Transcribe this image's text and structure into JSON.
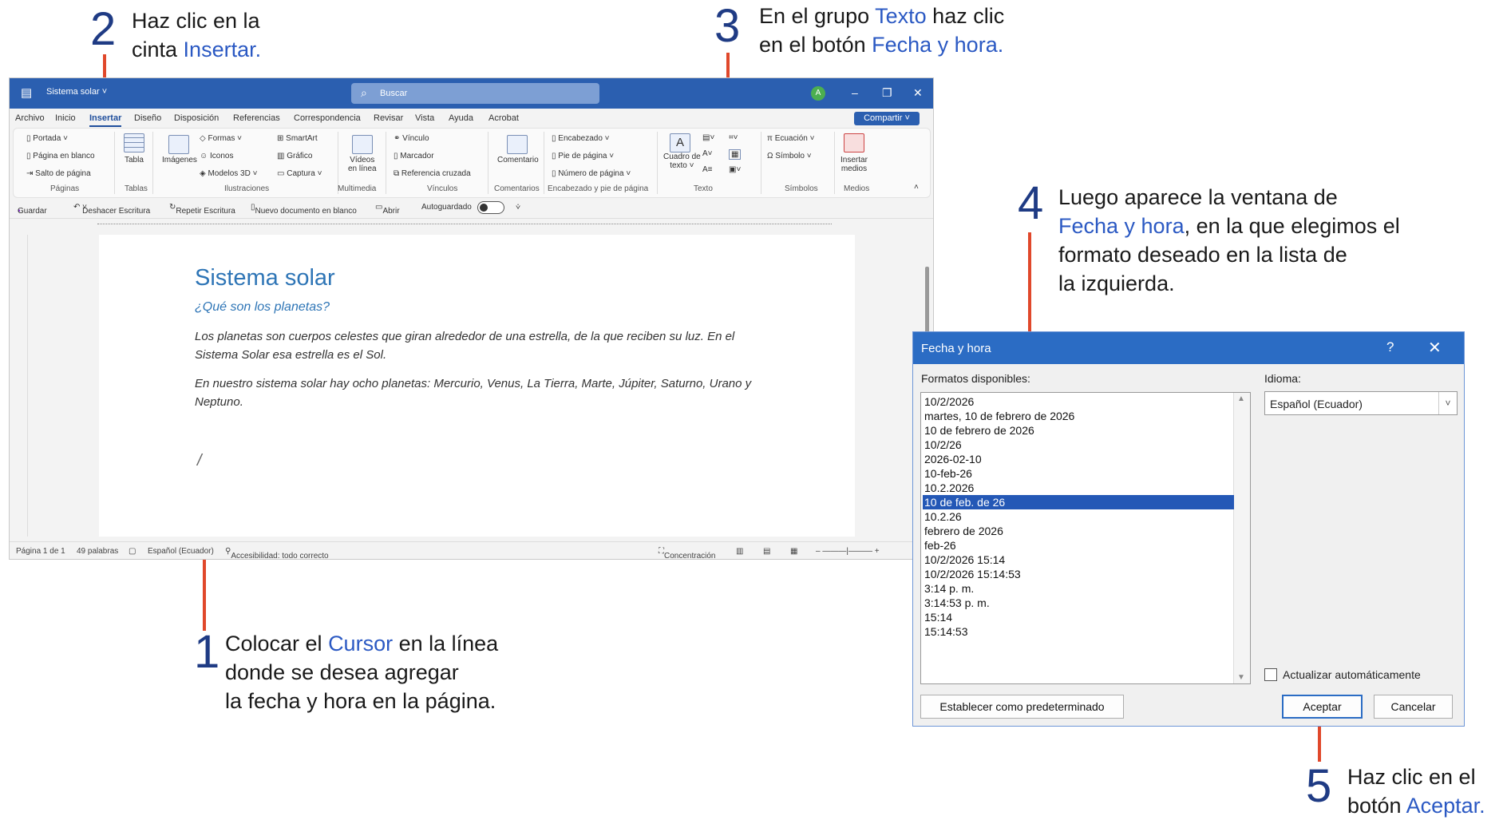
{
  "steps": {
    "s1": {
      "num": "1",
      "l1a": "Colocar el ",
      "l1b": "Cursor",
      "l1c": " en la línea",
      "l2": "donde se desea agregar",
      "l3": "la fecha y hora en la página."
    },
    "s2": {
      "num": "2",
      "l1": "Haz clic en la",
      "l2a": "cinta ",
      "l2b": "Insertar."
    },
    "s3": {
      "num": "3",
      "l1a": "En el grupo ",
      "l1b": "Texto",
      "l1c": " haz clic",
      "l2a": "en el botón ",
      "l2b": "Fecha y hora."
    },
    "s4": {
      "num": "4",
      "l1": "Luego aparece la ventana de",
      "l2a": "Fecha y hora",
      "l2b": ", en la que elegimos el",
      "l3": "formato deseado en la lista de",
      "l4": "la izquierda."
    },
    "s5": {
      "num": "5",
      "l1": "Haz clic en el",
      "l2a": "botón ",
      "l2b": "Aceptar."
    }
  },
  "word": {
    "doc_name": "Sistema solar ˅",
    "search_placeholder": "Buscar",
    "avatar": "A",
    "menu": [
      "Archivo",
      "Inicio",
      "Insertar",
      "Diseño",
      "Disposición",
      "Referencias",
      "Correspondencia",
      "Revisar",
      "Vista",
      "Ayuda",
      "Acrobat"
    ],
    "share": "Compartir ˅",
    "ribbon": {
      "portada": "Portada ˅",
      "pagina_blanco": "Página en blanco",
      "salto": "Salto de página",
      "g_paginas": "Páginas",
      "tabla": "Tabla",
      "g_tablas": "Tablas",
      "imagenes": "Imágenes",
      "formas": "Formas ˅",
      "iconos": "Iconos",
      "modelos": "Modelos 3D ˅",
      "smartart": "SmartArt",
      "grafico": "Gráfico",
      "captura": "Captura ˅",
      "g_ilustraciones": "Ilustraciones",
      "videos": "Vídeos",
      "videos2": "en línea",
      "g_multimedia": "Multimedia",
      "vinculo": "Vínculo",
      "marcador": "Marcador",
      "ref_cruzada": "Referencia cruzada",
      "g_vinculos": "Vínculos",
      "comentario": "Comentario",
      "g_comentarios": "Comentarios",
      "encabezado": "Encabezado ˅",
      "pie": "Pie de página ˅",
      "numero": "Número de página ˅",
      "g_encabezado": "Encabezado y pie de página",
      "cuadro": "Cuadro de",
      "cuadro2": "texto ˅",
      "g_texto": "Texto",
      "ecuacion": "Ecuación ˅",
      "simbolo": "Símbolo ˅",
      "g_simbolos": "Símbolos",
      "insertar_medios": "Insertar",
      "insertar_medios2": "medios",
      "g_medios": "Medios"
    },
    "qat": {
      "guardar": "Guardar",
      "deshacer": "Deshacer Escritura",
      "repetir": "Repetir Escritura",
      "nuevo": "Nuevo documento en blanco",
      "abrir": "Abrir",
      "autoguardado": "Autoguardado"
    },
    "document": {
      "title": "Sistema solar",
      "subtitle": "¿Qué son los planetas?",
      "p1": "Los planetas son cuerpos celestes que giran alrededor de una estrella, de la que reciben su luz. En el Sistema Solar esa estrella es el Sol.",
      "p2": "En nuestro sistema solar hay ocho planetas: Mercurio, Venus, La Tierra, Marte, Júpiter, Saturno, Urano y Neptuno.",
      "cursor": "/"
    },
    "status": {
      "page": "Página 1 de 1",
      "words": "49 palabras",
      "lang": "Español (Ecuador)",
      "access": "Accesibilidad: todo correcto",
      "focus": "Concentración"
    }
  },
  "dialog": {
    "title": "Fecha y hora",
    "help": "?",
    "close": "✕",
    "formats_label": "Formatos disponibles:",
    "formats": [
      "10/2/2026",
      "martes, 10 de febrero de 2026",
      "10 de febrero de 2026",
      "10/2/26",
      "2026-02-10",
      "10-feb-26",
      "10.2.2026",
      "10 de feb. de 26",
      "10.2.26",
      "febrero de 2026",
      "feb-26",
      "10/2/2026 15:14",
      "10/2/2026 15:14:53",
      "3:14 p. m.",
      "3:14:53 p. m.",
      "15:14",
      "15:14:53"
    ],
    "selected_index": 7,
    "lang_label": "Idioma:",
    "lang_value": "Español (Ecuador)",
    "auto_update": "Actualizar automáticamente",
    "set_default": "Establecer como predeterminado",
    "ok": "Aceptar",
    "cancel": "Cancelar"
  }
}
